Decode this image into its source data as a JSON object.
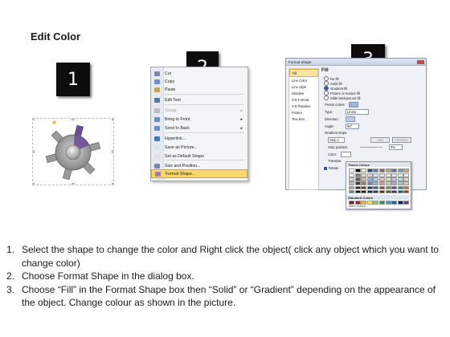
{
  "header": {
    "title": "Edit Color"
  },
  "badges": [
    "1",
    "2",
    "3"
  ],
  "context_menu": {
    "items": [
      {
        "label": "Cut",
        "underline": 2,
        "icon": "scissors-icon",
        "icon_color": "#7a8aa8",
        "disabled": false
      },
      {
        "label": "Copy",
        "underline": 0,
        "icon": "copy-icon",
        "icon_color": "#6a8fc8",
        "disabled": false
      },
      {
        "label": "Paste",
        "underline": 0,
        "icon": "paste-icon",
        "icon_color": "#c9a24a",
        "disabled": false
      },
      {
        "label": "Edit Text",
        "underline": 5,
        "icon": "edit-text-icon",
        "icon_color": "#5577aa",
        "disabled": false
      },
      {
        "label": "Group",
        "underline": 0,
        "icon": "group-icon",
        "icon_color": "#b8bcc4",
        "disabled": true,
        "submenu": true
      },
      {
        "label": "Bring to Front",
        "underline": 0,
        "icon": "bring-front-icon",
        "icon_color": "#6b8fc2",
        "disabled": false,
        "submenu": true
      },
      {
        "label": "Send to Back",
        "underline": 0,
        "icon": "send-back-icon",
        "icon_color": "#6b8fc2",
        "disabled": false,
        "submenu": true
      },
      {
        "label": "Hyperlink...",
        "underline": 0,
        "icon": "hyperlink-icon",
        "icon_color": "#3d78c7",
        "disabled": false
      },
      {
        "label": "Save as Picture...",
        "underline": 0,
        "icon": "save-picture-icon",
        "icon_color": "#dde1e6",
        "disabled": false
      },
      {
        "label": "Set as Default Shape",
        "underline": 0,
        "icon": "default-shape-icon",
        "icon_color": "#dde1e6",
        "disabled": false
      },
      {
        "label": "Size and Position...",
        "underline": 0,
        "icon": "size-position-icon",
        "icon_color": "#7a8aa8",
        "disabled": false
      },
      {
        "label": "Format Shape...",
        "underline": 0,
        "icon": "format-shape-icon",
        "icon_color": "#9a7fb8",
        "disabled": false,
        "highlighted": true
      }
    ]
  },
  "format_dialog": {
    "title": "Format Shape",
    "nav": [
      "Fill",
      "Line Color",
      "Line Style",
      "Shadow",
      "3-D Format",
      "3-D Rotation",
      "Picture",
      "Text Box"
    ],
    "selected_nav": "Fill",
    "section_title": "Fill",
    "fill_options": [
      {
        "label": "No fill",
        "selected": false
      },
      {
        "label": "Solid fill",
        "selected": false
      },
      {
        "label": "Gradient fill",
        "selected": true
      },
      {
        "label": "Picture or texture fill",
        "selected": false
      },
      {
        "label": "Slide background fill",
        "selected": false
      }
    ],
    "preset_colors_label": "Preset colors:",
    "type_label": "Type:",
    "type_value": "Linear",
    "direction_label": "Direction:",
    "angle_label": "Angle:",
    "angle_value": "90°",
    "gradient_stops_label": "Gradient stops",
    "stop_value": "Stop 1",
    "add_label": "Add",
    "remove_label": "Remove",
    "stop_position_label": "Stop position:",
    "stop_position_value": "0%",
    "color_label": "Color:",
    "transparency_label": "Transpar",
    "rotate_label": "Rotate"
  },
  "color_popup": {
    "theme_colors_label": "Theme Colors",
    "standard_colors_label": "Standard Colors",
    "more_colors_label": "More Colors...",
    "theme_top": [
      "#ffffff",
      "#000000",
      "#eeece1",
      "#1f497d",
      "#4f81bd",
      "#c0504d",
      "#9bbb59",
      "#8064a2",
      "#4bacc6",
      "#f79646"
    ],
    "theme_shades": [
      [
        "#f2f2f2",
        "#7f7f7f",
        "#ddd9c3",
        "#c6d9f0",
        "#dbe5f1",
        "#f2dcdb",
        "#ebf1dd",
        "#e5e0ec",
        "#dbeef3",
        "#fdeada"
      ],
      [
        "#d8d8d8",
        "#595959",
        "#c4bd97",
        "#8db3e2",
        "#b8cce4",
        "#e5b9b7",
        "#d7e3bc",
        "#ccc1d9",
        "#b7dde8",
        "#fbd5b5"
      ],
      [
        "#bfbfbf",
        "#3f3f3f",
        "#938953",
        "#548dd4",
        "#95b3d7",
        "#d99694",
        "#c3d69b",
        "#b2a2c7",
        "#92cddc",
        "#fac08f"
      ],
      [
        "#a5a5a5",
        "#262626",
        "#494429",
        "#17365d",
        "#366092",
        "#953734",
        "#76923c",
        "#5f497a",
        "#31859b",
        "#e36c09"
      ],
      [
        "#7f7f7f",
        "#0c0c0c",
        "#1d1b10",
        "#0f243e",
        "#244061",
        "#632423",
        "#4f6128",
        "#3f3151",
        "#205867",
        "#974806"
      ]
    ],
    "standard": [
      "#c00000",
      "#ff0000",
      "#ffc000",
      "#ffff00",
      "#92d050",
      "#00b050",
      "#00b0f0",
      "#0070c0",
      "#002060",
      "#7030a0"
    ]
  },
  "gear": {
    "body_color": "#9a9a9a",
    "highlight_color": "#6b4c9a"
  },
  "steps": [
    {
      "num": "1.",
      "text": "Select the shape to change the color and Right click the object( click any object which you want to change color)"
    },
    {
      "num": "2.",
      "text": "Choose Format Shape in the dialog box."
    },
    {
      "num": "3.",
      "text": "Choose “Fill” in the Format Shape box then “Solid” or “Gradient” depending on the appearance of the object. Change colour as shown in the picture."
    }
  ]
}
